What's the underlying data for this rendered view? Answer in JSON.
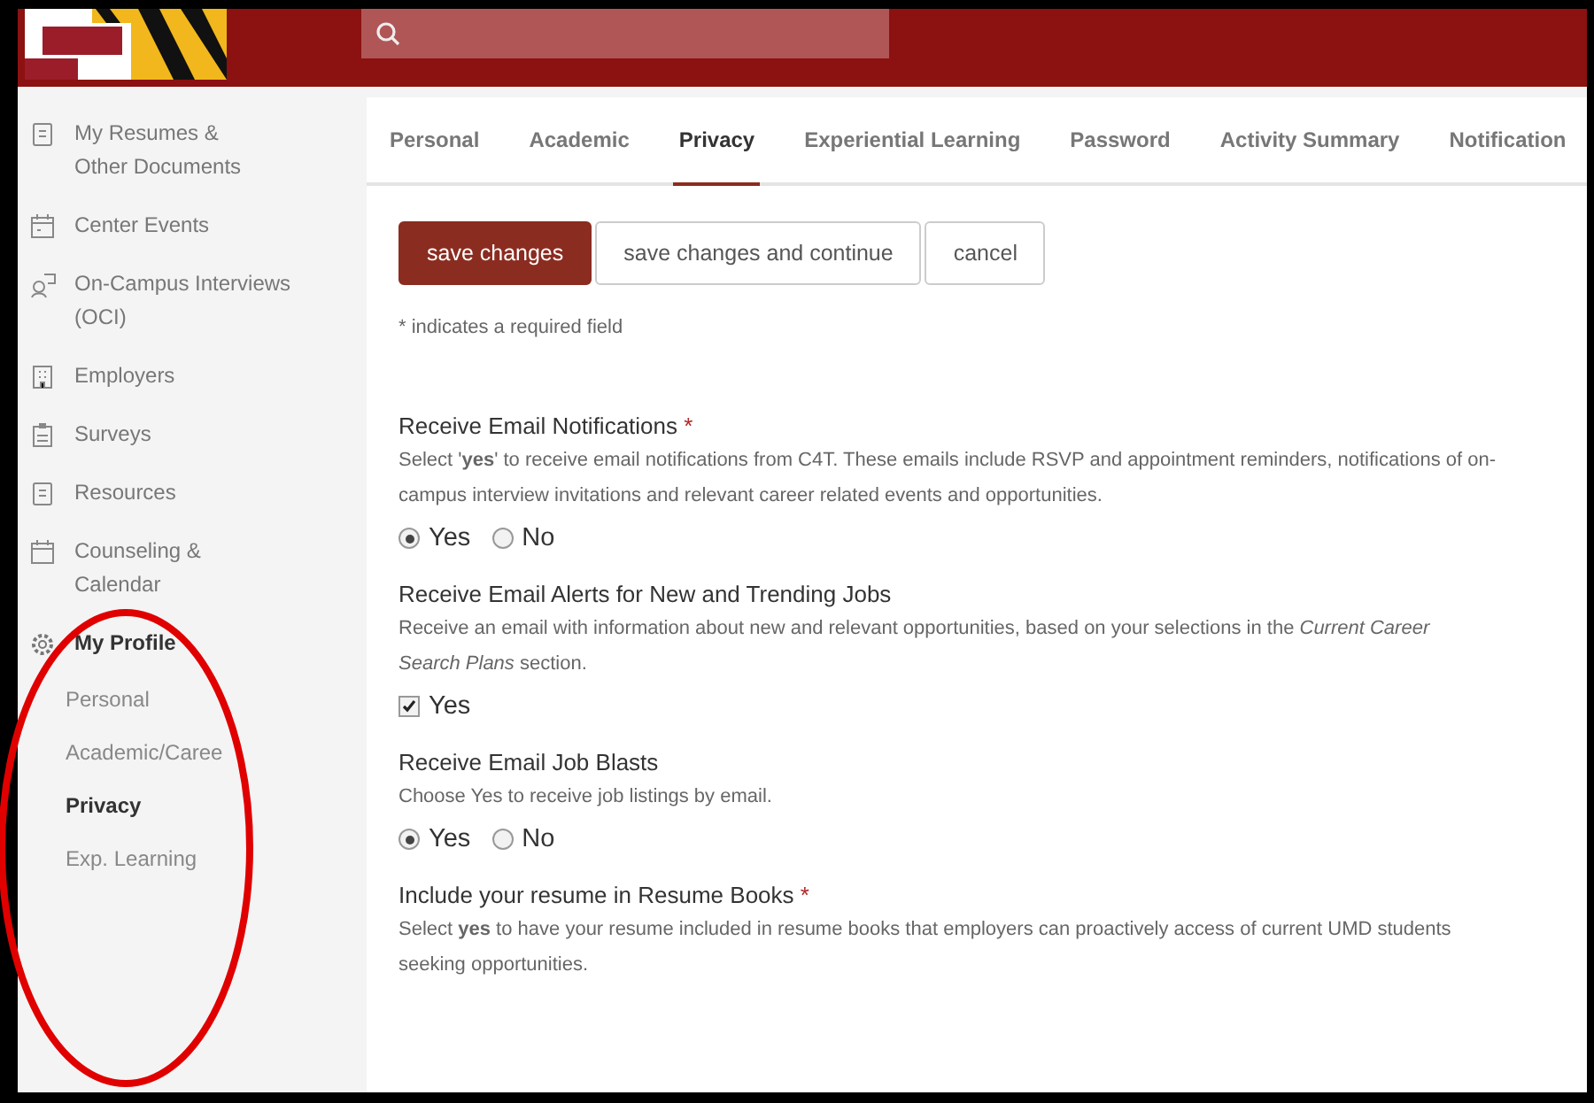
{
  "sidebar": {
    "items": [
      {
        "label": "My Resumes &\nOther Documents",
        "selected": false
      },
      {
        "label": "Center Events",
        "selected": false
      },
      {
        "label": "On-Campus Interviews\n(OCI)",
        "selected": false
      },
      {
        "label": "Employers",
        "selected": false
      },
      {
        "label": "Surveys",
        "selected": false
      },
      {
        "label": "Resources",
        "selected": false
      },
      {
        "label": "Counseling &\nCalendar",
        "selected": false
      },
      {
        "label": "My Profile",
        "selected": true,
        "children": [
          {
            "label": "Personal",
            "selected": false
          },
          {
            "label": "Academic/Caree",
            "selected": false
          },
          {
            "label": "Privacy",
            "selected": true
          },
          {
            "label": "Exp. Learning",
            "selected": false
          }
        ]
      }
    ]
  },
  "tabs": [
    {
      "label": "Personal",
      "selected": false
    },
    {
      "label": "Academic",
      "selected": false
    },
    {
      "label": "Privacy",
      "selected": true
    },
    {
      "label": "Experiential Learning",
      "selected": false
    },
    {
      "label": "Password",
      "selected": false
    },
    {
      "label": "Activity Summary",
      "selected": false
    },
    {
      "label": "Notification",
      "selected": false
    }
  ],
  "buttons": [
    {
      "label": "save changes",
      "kind": "primary"
    },
    {
      "label": "save changes and continue",
      "kind": "secondary"
    },
    {
      "label": "cancel",
      "kind": "secondary"
    }
  ],
  "required_note": "* indicates a required field",
  "sections": [
    {
      "title": "Receive Email Notifications",
      "required_mark": "*",
      "description": "Select '**yes**' to receive email notifications from C4T. These emails include RSVP and appointment reminders, notifications of on-campus interview invitations and relevant career related events and opportunities.",
      "kind": "radio",
      "options": [
        {
          "label": "Yes",
          "selected": true
        },
        {
          "label": "No",
          "selected": false
        }
      ]
    },
    {
      "title": "Receive Email Alerts for New and Trending Jobs",
      "description": "Receive an email with information about new and relevant opportunities, based on your selections in the *Current Career Search Plans* section.",
      "kind": "checkbox",
      "option": {
        "label": "Yes",
        "checked": true
      }
    },
    {
      "title": "Receive Email Job Blasts",
      "description": "Choose Yes to receive job listings by email.",
      "kind": "radio",
      "options": [
        {
          "label": "Yes",
          "selected": true
        },
        {
          "label": "No",
          "selected": false
        }
      ]
    },
    {
      "title": "Include your resume in Resume Books",
      "required_mark": "*",
      "description": "Select **yes** to have your resume included in resume books that employers can proactively access of current UMD students seeking opportunities.",
      "kind": "none"
    }
  ]
}
